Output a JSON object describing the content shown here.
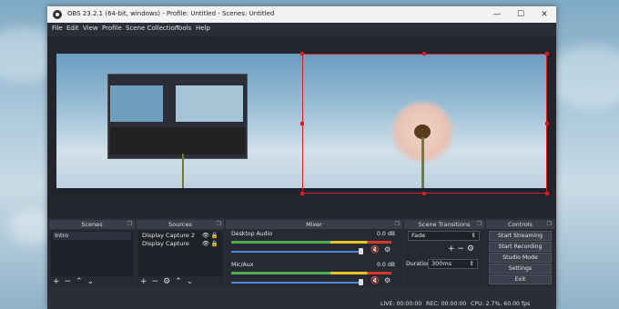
{
  "window": {
    "title": "OBS 23.2.1 (64-bit, windows) - Profile: Untitled - Scenes: Untitled",
    "controls": {
      "minimize": "—",
      "maximize": "☐",
      "close": "✕"
    }
  },
  "menu": [
    "File",
    "Edit",
    "View",
    "Profile",
    "Scene Collection",
    "Tools",
    "Help"
  ],
  "scenes": {
    "header": "Scenes",
    "items": [
      "Intro"
    ]
  },
  "sources": {
    "header": "Sources",
    "items": [
      "Display Capture 2",
      "Display Capture"
    ]
  },
  "mixer": {
    "header": "Mixer",
    "tracks": [
      {
        "name": "Desktop Audio",
        "db": "0.0 dB"
      },
      {
        "name": "Mic/Aux",
        "db": "0.0 dB"
      }
    ]
  },
  "transitions": {
    "header": "Scene Transitions",
    "selected": "Fade",
    "duration_label": "Duration",
    "duration_value": "300ms"
  },
  "controls": {
    "header": "Controls",
    "buttons": [
      "Start Streaming",
      "Start Recording",
      "Studio Mode",
      "Settings",
      "Exit"
    ]
  },
  "status": {
    "live": "LIVE: 00:00:00",
    "rec": "REC: 00:00:00",
    "cpu": "CPU: 2.7%, 60.00 fps"
  },
  "colors": {
    "selection": "#d21f26",
    "panel": "#272a33",
    "meter_green": "#4caf50"
  }
}
